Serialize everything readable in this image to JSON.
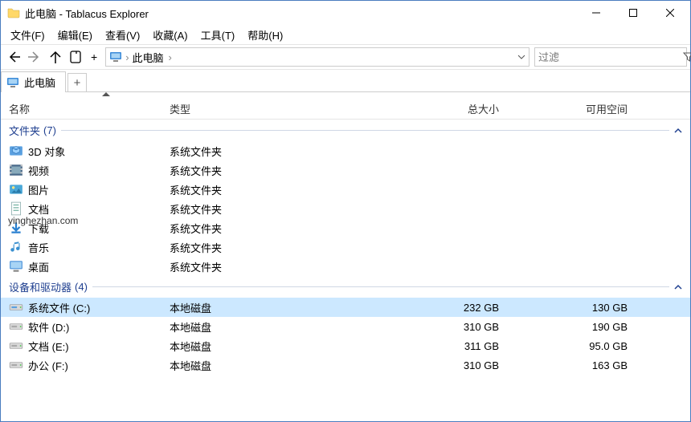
{
  "window": {
    "title": "此电脑 - Tablacus Explorer"
  },
  "menu": [
    "文件(F)",
    "编辑(E)",
    "查看(V)",
    "收藏(A)",
    "工具(T)",
    "帮助(H)"
  ],
  "address": {
    "text": "此电脑",
    "sep": "›"
  },
  "filter": {
    "placeholder": "过滤"
  },
  "tab": {
    "label": "此电脑"
  },
  "columns": {
    "name": "名称",
    "type": "类型",
    "size": "总大小",
    "free": "可用空间"
  },
  "groups": [
    {
      "label": "文件夹",
      "count": "(7)",
      "items": [
        {
          "icon": "3d",
          "name": "3D 对象",
          "type": "系统文件夹"
        },
        {
          "icon": "video",
          "name": "视频",
          "type": "系统文件夹"
        },
        {
          "icon": "pictures",
          "name": "图片",
          "type": "系统文件夹"
        },
        {
          "icon": "docs",
          "name": "文档",
          "type": "系统文件夹"
        },
        {
          "icon": "downloads",
          "name": "下载",
          "type": "系统文件夹"
        },
        {
          "icon": "music",
          "name": "音乐",
          "type": "系统文件夹"
        },
        {
          "icon": "desktop",
          "name": "桌面",
          "type": "系统文件夹"
        }
      ]
    },
    {
      "label": "设备和驱动器",
      "count": "(4)",
      "items": [
        {
          "icon": "drive-sys",
          "name": "系统文件 (C:)",
          "type": "本地磁盘",
          "size": "232 GB",
          "free": "130 GB",
          "selected": true
        },
        {
          "icon": "drive",
          "name": "软件 (D:)",
          "type": "本地磁盘",
          "size": "310 GB",
          "free": "190 GB"
        },
        {
          "icon": "drive",
          "name": "文档 (E:)",
          "type": "本地磁盘",
          "size": "311 GB",
          "free": "95.0 GB"
        },
        {
          "icon": "drive",
          "name": "办公 (F:)",
          "type": "本地磁盘",
          "size": "310 GB",
          "free": "163 GB"
        }
      ]
    }
  ],
  "watermark": "yinghezhan.com"
}
